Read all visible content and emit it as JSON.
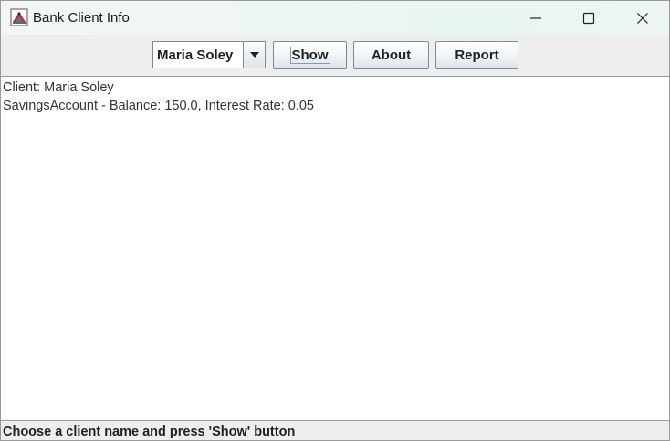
{
  "window": {
    "title": "Bank Client Info",
    "icon": "java-app-icon",
    "controls": [
      "minimize-icon",
      "maximize-icon",
      "close-icon"
    ]
  },
  "toolbar": {
    "client_select": {
      "selected": "Maria Soley"
    },
    "show_label": "Show",
    "about_label": "About",
    "report_label": "Report"
  },
  "content": {
    "lines": [
      "Client: Maria Soley",
      "SavingsAccount - Balance: 150.0, Interest Rate: 0.05"
    ]
  },
  "status": {
    "text": "Choose a client name and press 'Show' button"
  }
}
